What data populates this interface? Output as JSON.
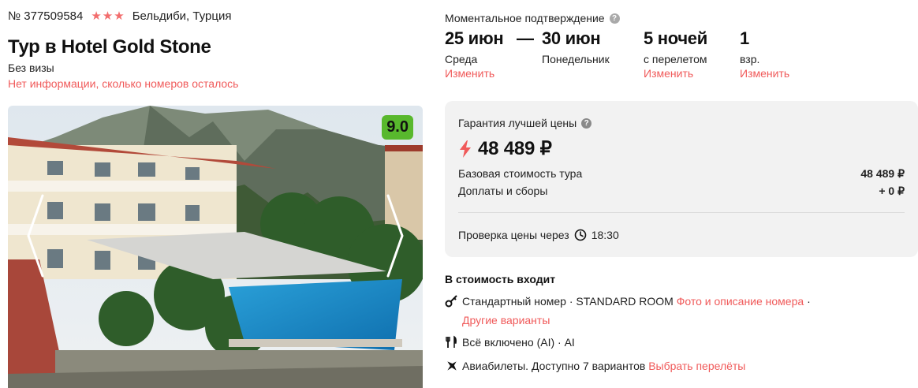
{
  "tour": {
    "number": "№ 377509584",
    "stars": 3,
    "location": "Бельдиби, Турция",
    "title": "Тур в Hotel Gold Stone",
    "visa": "Без визы",
    "rooms_info": "Нет информации, сколько номеров осталось",
    "rating": "9.0"
  },
  "booking": {
    "confirm_label": "Моментальное подтверждение",
    "help_icon": "?",
    "date_from": "25 июн",
    "date_from_day": "Среда",
    "dash": "—",
    "date_to": "30 июн",
    "date_to_day": "Понедельник",
    "nights": "5 ночей",
    "nights_sub": "с перелетом",
    "adults": "1",
    "adults_sub": "взр.",
    "change_label": "Изменить"
  },
  "price": {
    "guarantee": "Гарантия лучшей цены",
    "total": "48 489 ₽",
    "base_label": "Базовая стоимость тура",
    "base_value": "48 489 ₽",
    "fees_label": "Доплаты и сборы",
    "fees_value": "+ 0 ₽",
    "check_label": "Проверка цены через",
    "check_time": "18:30"
  },
  "included": {
    "title": "В стоимость входит",
    "room_text": "Стандартный номер · STANDARD ROOM",
    "room_link": "Фото и описание номера",
    "room_sep": "·",
    "room_other": "Другие варианты",
    "meal_text": "Всё включено (AI) · AI",
    "flight_text": "Авиабилеты. Доступно 7 вариантов",
    "flight_link": "Выбрать перелёты"
  },
  "icons": {
    "star": "star-icon",
    "help": "question-icon",
    "bolt": "bolt-icon",
    "clock": "clock-icon",
    "key": "key-icon",
    "meal": "fork-knife-icon",
    "plane": "plane-icon"
  },
  "colors": {
    "accent_red": "#f05a5a",
    "rating_green": "#58b82d",
    "box_gray": "#f2f2f2"
  }
}
